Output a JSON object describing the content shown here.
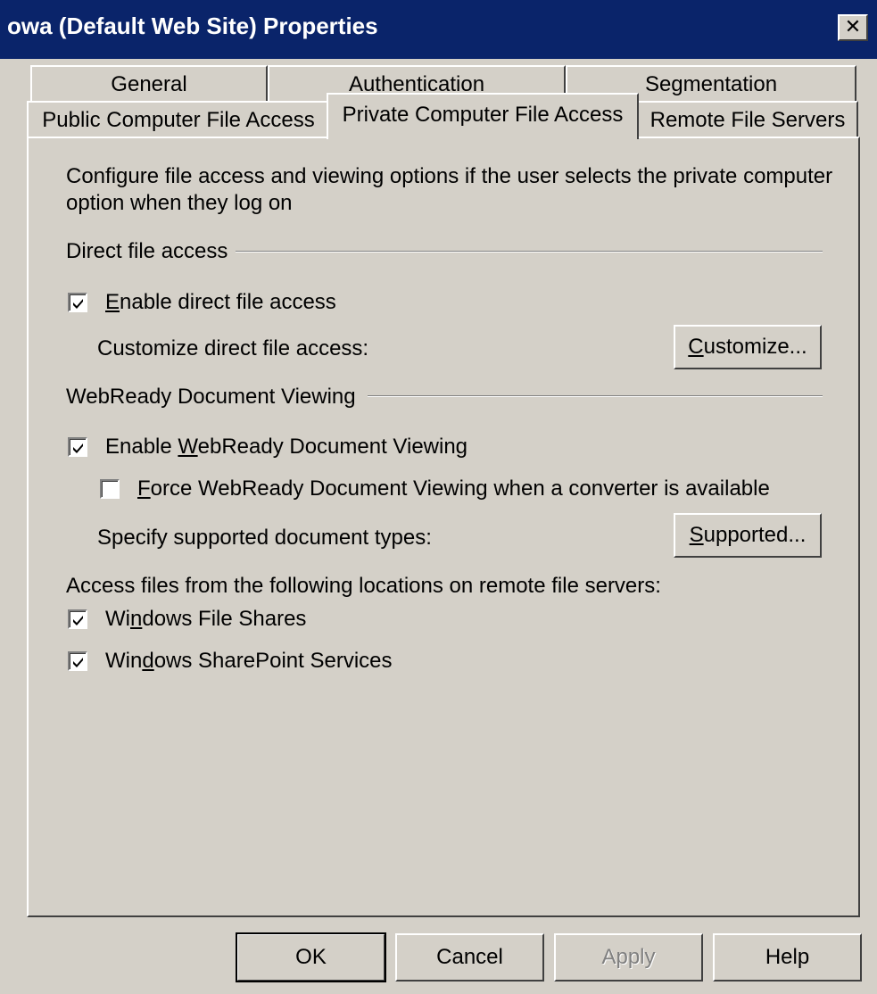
{
  "window": {
    "title": "owa (Default Web Site) Properties",
    "close_glyph": "✕"
  },
  "tabs_row1": [
    "General",
    "Authentication",
    "Segmentation"
  ],
  "tabs_row2": [
    "Public Computer File Access",
    "Private Computer File Access",
    "Remote File Servers"
  ],
  "active_tab": "Private Computer File Access",
  "panel": {
    "description": "Configure file access and viewing options if the user selects the private computer option when they log on",
    "direct_group": "Direct file access",
    "enable_direct": {
      "label_pre": "",
      "label_u": "E",
      "label_post": "nable direct file access",
      "checked": true
    },
    "customize_label": "Customize direct file access:",
    "customize_button": {
      "u": "C",
      "rest": "ustomize..."
    },
    "webready_group": "WebReady Document Viewing",
    "enable_webready": {
      "label_pre": "Enable ",
      "label_u": "W",
      "label_post": "ebReady Document Viewing",
      "checked": true
    },
    "force_webready": {
      "label_pre": "",
      "label_u": "F",
      "label_post": "orce WebReady Document Viewing when a converter is available",
      "checked": false
    },
    "supported_label": "Specify supported document types:",
    "supported_button": {
      "u": "S",
      "rest": "upported..."
    },
    "remote_label": "Access files from the following locations on remote file servers:",
    "file_shares": {
      "label_pre": "Wi",
      "label_u": "n",
      "label_post": "dows File Shares",
      "checked": true
    },
    "sharepoint": {
      "label_pre": "Win",
      "label_u": "d",
      "label_post": "ows SharePoint Services",
      "checked": true
    }
  },
  "buttons": {
    "ok": "OK",
    "cancel": "Cancel",
    "apply": "Apply",
    "help": "Help"
  },
  "colors": {
    "titlebar": "#0a246a",
    "face": "#d4d0c8"
  }
}
